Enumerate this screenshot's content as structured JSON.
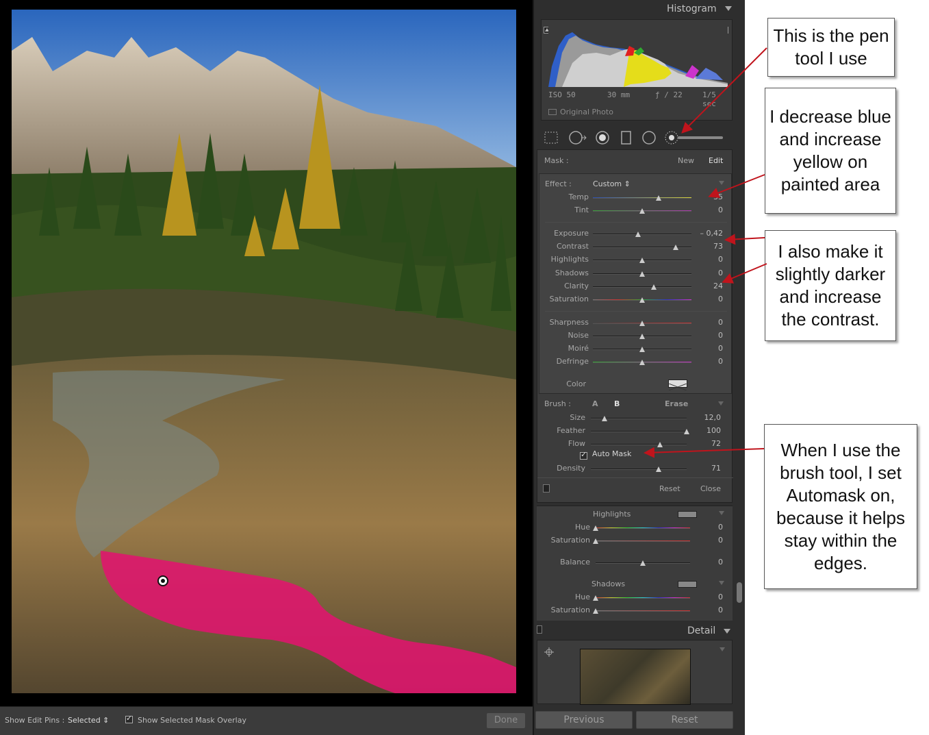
{
  "histogram": {
    "title": "Histogram",
    "exif": {
      "iso": "ISO 50",
      "focal": "30 mm",
      "aperture": "ƒ / 22",
      "shutter": "1/5 sec"
    },
    "original_photo_label": "Original Photo"
  },
  "mask": {
    "label": "Mask :",
    "new_label": "New",
    "edit_label": "Edit",
    "effect_label": "Effect :",
    "effect_value": "Custom ⇕",
    "sliders_group1": [
      {
        "label": "Temp",
        "value": "35",
        "pos": 0.67
      },
      {
        "label": "Tint",
        "value": "0",
        "pos": 0.5
      }
    ],
    "sliders_group2": [
      {
        "label": "Exposure",
        "value": "– 0,42",
        "pos": 0.46
      },
      {
        "label": "Contrast",
        "value": "73",
        "pos": 0.84
      },
      {
        "label": "Highlights",
        "value": "0",
        "pos": 0.5
      },
      {
        "label": "Shadows",
        "value": "0",
        "pos": 0.5
      },
      {
        "label": "Clarity",
        "value": "24",
        "pos": 0.62
      },
      {
        "label": "Saturation",
        "value": "0",
        "pos": 0.5
      }
    ],
    "sliders_group3": [
      {
        "label": "Sharpness",
        "value": "0",
        "pos": 0.5
      },
      {
        "label": "Noise",
        "value": "0",
        "pos": 0.5
      },
      {
        "label": "Moiré",
        "value": "0",
        "pos": 0.5
      },
      {
        "label": "Defringe",
        "value": "0",
        "pos": 0.5
      }
    ],
    "color_label": "Color",
    "brush_label": "Brush :",
    "brush_a": "A",
    "brush_b": "B",
    "brush_erase": "Erase",
    "brush_sliders": [
      {
        "label": "Size",
        "value": "12,0",
        "pos": 0.14
      },
      {
        "label": "Feather",
        "value": "100",
        "pos": 1.0
      },
      {
        "label": "Flow",
        "value": "72",
        "pos": 0.72
      }
    ],
    "auto_mask_label": "Auto Mask",
    "density_slider": {
      "label": "Density",
      "value": "71",
      "pos": 0.71
    },
    "reset_label": "Reset",
    "close_label": "Close"
  },
  "split_toning": {
    "highlights_label": "Highlights",
    "highlights_sliders": [
      {
        "label": "Hue",
        "value": "0",
        "pos": 0.0
      },
      {
        "label": "Saturation",
        "value": "0",
        "pos": 0.0
      }
    ],
    "balance_slider": {
      "label": "Balance",
      "value": "0",
      "pos": 0.5
    },
    "shadows_label": "Shadows",
    "shadows_sliders": [
      {
        "label": "Hue",
        "value": "0",
        "pos": 0.0
      },
      {
        "label": "Saturation",
        "value": "0",
        "pos": 0.0
      }
    ]
  },
  "detail": {
    "title": "Detail"
  },
  "footer": {
    "previous_label": "Previous",
    "reset_label": "Reset"
  },
  "toolbar": {
    "show_edit_pins_label": "Show Edit Pins :",
    "show_edit_pins_value": "Selected ⇕",
    "show_overlay_label": "Show Selected Mask Overlay",
    "done_label": "Done"
  },
  "callouts": {
    "pen_tool": "This is the pen tool I use",
    "color": "I decrease blue and increase yellow on painted area",
    "darker": "I also make it slightly darker and increase the contrast.",
    "brush": "When I use the brush tool, I set Automask on, because it helps stay within the edges."
  },
  "colors": {
    "mask_overlay": "#e0146e",
    "arrow": "#c0141c",
    "panel_bg": "#3c3c3c"
  }
}
